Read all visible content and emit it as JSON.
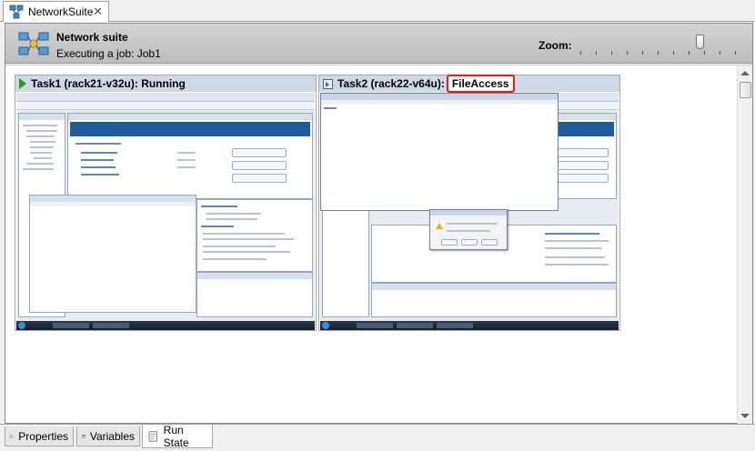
{
  "document_tab": {
    "label": "NetworkSuite",
    "close": "✕"
  },
  "header": {
    "title": "Network suite",
    "subtitle": "Executing a job: Job1",
    "zoom_label": "Zoom:"
  },
  "tasks": [
    {
      "name": "Task1 (rack21-v32u):",
      "status": "Running",
      "status_icon": "play-icon",
      "status_color": "#1ea11e"
    },
    {
      "name": "Task2 (rack22-v64u):",
      "status": "FileAccess",
      "status_icon": "file-access-icon",
      "highlight_color": "#e81919"
    }
  ],
  "bottom_tabs": [
    {
      "label": "Properties",
      "icon": "properties-icon"
    },
    {
      "label": "Variables",
      "icon": "variables-icon"
    },
    {
      "label": "Run State",
      "icon": "run-state-icon",
      "active": true
    }
  ],
  "colors": {
    "task_title_bg": "#cfd8e6",
    "header_bg": "#c8c8c8"
  }
}
